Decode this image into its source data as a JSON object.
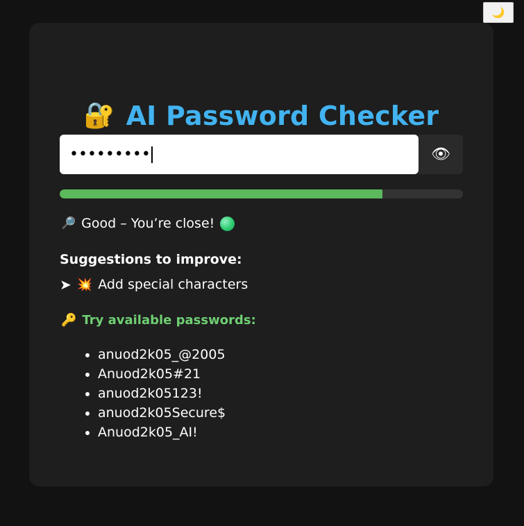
{
  "theme_toggle": {
    "icon": "🌙",
    "icon_name": "moon-icon"
  },
  "header": {
    "icon": "🔐",
    "icon_name": "lock-with-key-icon",
    "title": "AI Password Checker"
  },
  "password_field": {
    "masked_value": "•••••••••"
  },
  "visibility_toggle": {
    "icon": "👁",
    "icon_name": "eye-icon"
  },
  "strength": {
    "fraction": 0.8,
    "color": "#5cb85c",
    "track_color": "#333333"
  },
  "status": {
    "icon": "🔎",
    "icon_name": "magnifier-icon",
    "text": "Good – You’re close!",
    "indicator_color": "#2ecc71"
  },
  "suggestions": {
    "title": "Suggestions to improve:",
    "items": [
      {
        "arrow": "➤",
        "icon": "💥",
        "icon_name": "sparkle-burst-icon",
        "text": "Add special characters"
      }
    ]
  },
  "available": {
    "icon": "🔑",
    "icon_name": "key-icon",
    "title": "Try available passwords:",
    "items": [
      "anuod2k05_@2005",
      "Anuod2k05#21",
      "anuod2k05123!",
      "anuod2k05Secure$",
      "Anuod2k05_AI!"
    ]
  },
  "colors": {
    "accent": "#42b3f0",
    "card": "#1e1e1e",
    "background": "#121212",
    "try_title": "#6fcf73"
  }
}
